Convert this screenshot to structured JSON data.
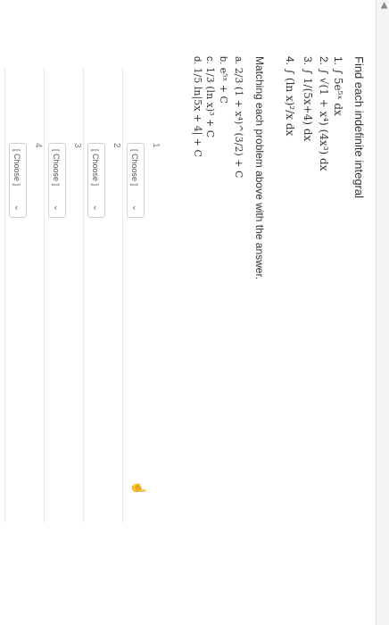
{
  "question": {
    "title": "Find each indefinite integral",
    "problems": [
      {
        "num": "1.",
        "expr": "∫ 5e⁵ˣ dx"
      },
      {
        "num": "2.",
        "expr": "∫ √(1 + x⁴) (4x³) dx"
      },
      {
        "num": "3.",
        "expr": "∫ 1/(5x+4) dx"
      },
      {
        "num": "4.",
        "expr": "∫ (ln x)²/x dx"
      }
    ],
    "match_title": "Matching each problem above with the answer.",
    "answers": [
      {
        "label": "a.",
        "expr": "2/3 (1 + x⁴)^(3/2) + C"
      },
      {
        "label": "b.",
        "expr": "e⁵ˣ + C"
      },
      {
        "label": "c.",
        "expr": "1/3 (ln x)³ + C"
      },
      {
        "label": "d.",
        "expr": "1/5 ln|5x + 4| + C"
      }
    ],
    "rows": [
      {
        "num": "1",
        "select": "[ Choose ]"
      },
      {
        "num": "2",
        "select": "[ Choose ]"
      },
      {
        "num": "3",
        "select": "[ Choose ]"
      },
      {
        "num": "4",
        "select": "[ Choose ]"
      }
    ]
  },
  "icons": {
    "chevron": "chevron-down-icon",
    "cursor": "hand-cursor-icon"
  }
}
